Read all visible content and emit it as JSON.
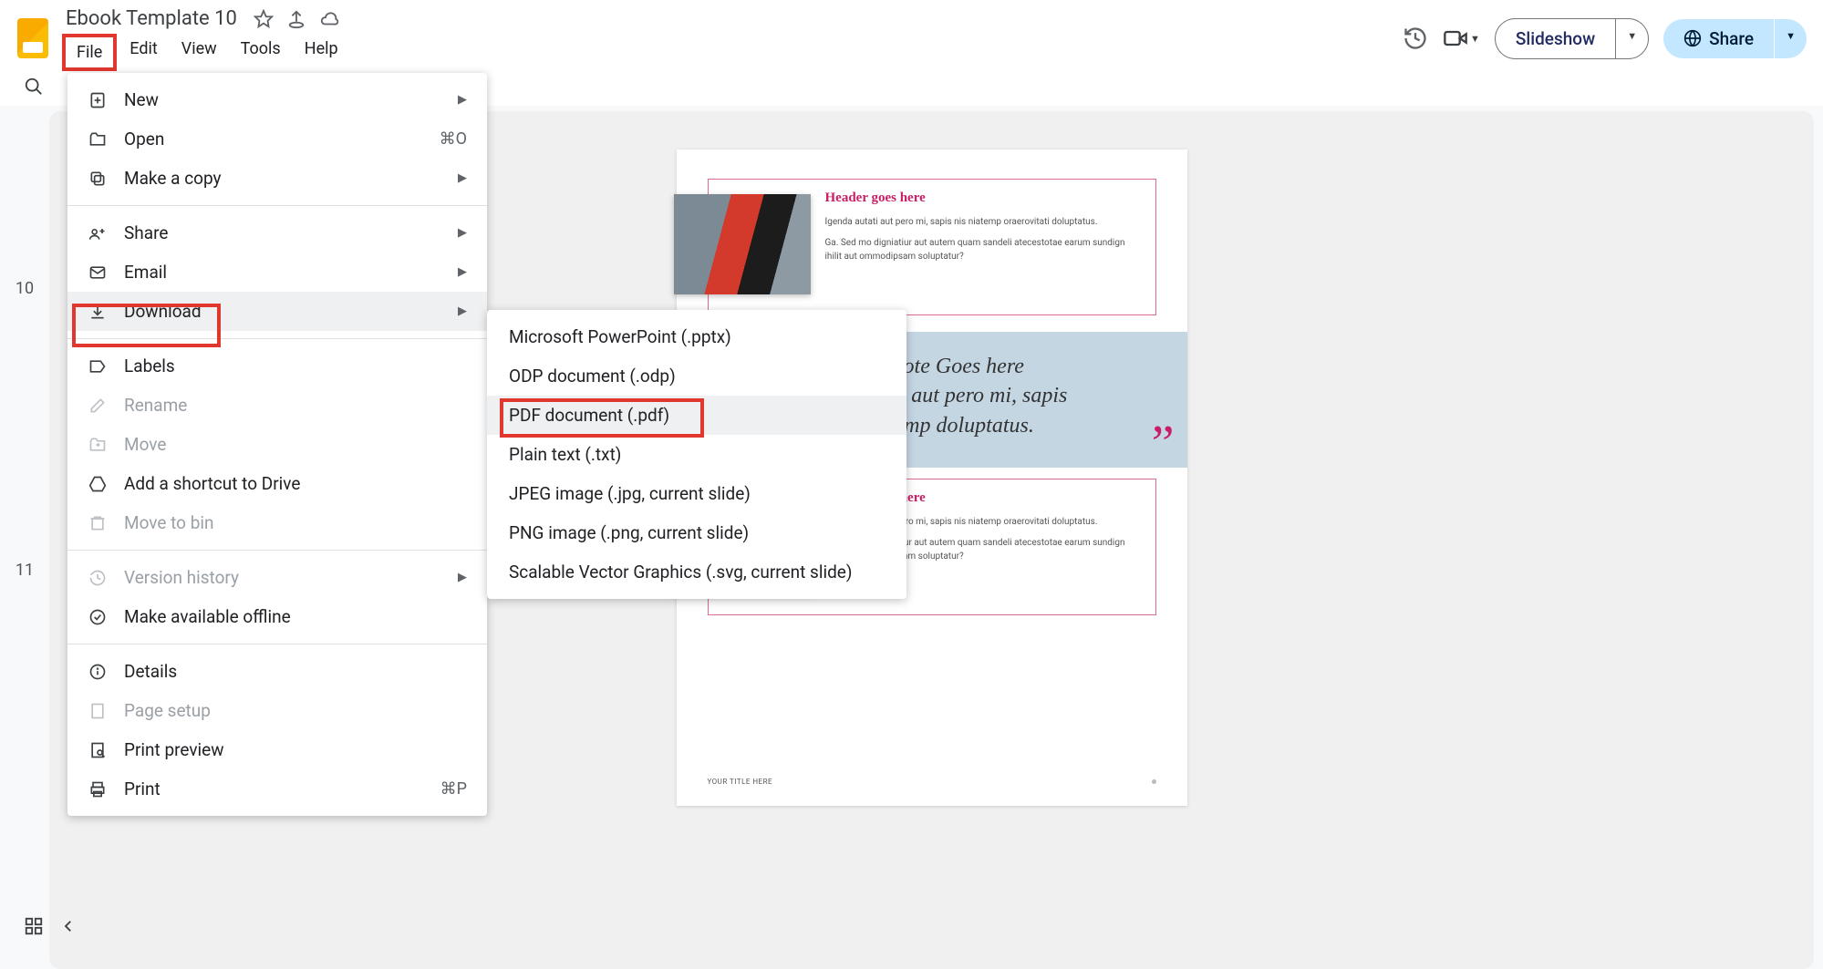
{
  "header": {
    "doc_title": "Ebook Template 10",
    "menus": [
      "File",
      "Edit",
      "View",
      "Tools",
      "Help"
    ],
    "slideshow_label": "Slideshow",
    "share_label": "Share"
  },
  "filmstrip": {
    "slide_a": "10",
    "slide_b": "11"
  },
  "file_menu": {
    "new": "New",
    "open": "Open",
    "open_shortcut": "⌘O",
    "make_copy": "Make a copy",
    "share": "Share",
    "email": "Email",
    "download": "Download",
    "labels": "Labels",
    "rename": "Rename",
    "move": "Move",
    "shortcut_drive": "Add a shortcut to Drive",
    "move_bin": "Move to bin",
    "version_history": "Version history",
    "offline": "Make available offline",
    "details": "Details",
    "page_setup": "Page setup",
    "print_preview": "Print preview",
    "print": "Print",
    "print_shortcut": "⌘P"
  },
  "download_submenu": {
    "pptx": "Microsoft PowerPoint (.pptx)",
    "odp": "ODP document (.odp)",
    "pdf": "PDF document (.pdf)",
    "txt": "Plain text (.txt)",
    "jpeg": "JPEG image (.jpg, current slide)",
    "png": "PNG image (.png, current slide)",
    "svg": "Scalable Vector Graphics (.svg, current slide)"
  },
  "slide": {
    "card1_header": "Header goes here",
    "card1_p1": "Igenda autati aut pero mi, sapis nis niatemp oraerovitati doluptatus.",
    "card1_p2": "Ga. Sed mo digniatiur aut autem quam sandeli atecestotae earum sundign ihilit aut ommodipsam soluptatur?",
    "quote_line1": "You Quote Goes here",
    "quote_line2": "genda autati aut pero mi, sapis",
    "quote_line3": "nis niatemp doluptatus.",
    "card2_header": "Header goes here",
    "card2_p1": "Igenda autati aut pero mi, sapis nis niatemp oraerovitati doluptatus.",
    "card2_p2": "Ga. Sed mo digniatiur aut autem quam sandeli atecestotae earum sundign ihilit aut ommodipsam soluptatur?",
    "footer": "YOUR TITLE HERE"
  }
}
